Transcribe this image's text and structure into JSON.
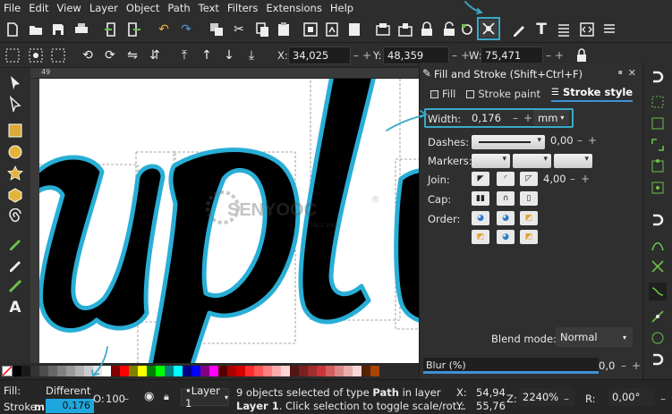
{
  "menu": [
    "File",
    "Edit",
    "View",
    "Layer",
    "Object",
    "Path",
    "Text",
    "Filters",
    "Extensions",
    "Help"
  ],
  "toolbar_icons": [
    "new-icon",
    "open-icon",
    "save-icon",
    "print-icon",
    "import-icon",
    "export-icon",
    "undo-icon",
    "redo-icon",
    "duplicate-icon",
    "cut-icon",
    "copy-icon",
    "paste-icon",
    "zoom-fit-icon",
    "zoom-drawing-icon",
    "zoom-page-icon",
    "group-icon",
    "ungroup-icon",
    "lock-icon",
    "unlock-icon",
    "node-editor-icon",
    "fill-stroke-icon",
    "pen-icon",
    "text-icon",
    "align-icon",
    "xml-editor-icon",
    "more-icon"
  ],
  "controls": {
    "x_label": "X:",
    "x_value": "34,025",
    "y_label": "Y:",
    "y_value": "48,359",
    "w_label": "W:",
    "w_value": "75,471"
  },
  "ruler": {
    "tick_label": "49"
  },
  "canvas": {
    "text": "upl",
    "watermark": "SENYOOC",
    "watermark_sub": "SINCE 2008"
  },
  "dialog": {
    "title": "Fill and Stroke (Shift+Ctrl+F)",
    "tabs": [
      "Fill",
      "Stroke paint",
      "Stroke style"
    ],
    "width_label": "Width:",
    "width_value": "0,176",
    "width_unit": "mm",
    "dashes_label": "Dashes:",
    "dashes_value": "0,00",
    "markers_label": "Markers:",
    "join_label": "Join:",
    "join_value": "4,00",
    "cap_label": "Cap:",
    "order_label": "Order:",
    "blend_label": "Blend mode:",
    "blend_value": "Normal",
    "blur_label": "Blur (%)",
    "blur_value": "0,0"
  },
  "palette": [
    "#000000",
    "#1a1a1a",
    "#333333",
    "#4d4d4d",
    "#666666",
    "#808080",
    "#999999",
    "#b3b3b3",
    "#cccccc",
    "#e6e6e6",
    "#ffffff",
    "#800000",
    "#ff0000",
    "#808000",
    "#ffff00",
    "#008000",
    "#00ff00",
    "#008080",
    "#00ffff",
    "#000080",
    "#0000ff",
    "#800080",
    "#ff00ff",
    "#550000",
    "#aa0000",
    "#d40000",
    "#ff2a2a",
    "#ff5555",
    "#ff8080",
    "#ffaaaa",
    "#ffd5d5",
    "#501616",
    "#782121",
    "#a02c2c",
    "#c83737",
    "#d35f5f",
    "#de8787",
    "#e9afaf",
    "#f4d7d7",
    "#552200",
    "#aa4400"
  ],
  "status": {
    "fill_label": "Fill:",
    "fill_value": "Different",
    "stroke_label": "Stroke:",
    "stroke_value": "0,176",
    "opacity_label": "O:",
    "opacity_value": "100",
    "layer": "•Layer 1",
    "message_line1_prefix": "9 objects selected of type ",
    "message_type": "Path",
    "message_line1_suffix": " in layer",
    "message_line2_layer": "Layer 1",
    "message_line2": ". Click selection to toggle scale/rot...",
    "x_label": "X:",
    "x_value": "54,94",
    "y_label": "Y:",
    "y_value": "55,76",
    "z_label": "Z:",
    "z_value": "2240%",
    "r_label": "R:",
    "r_value": "0,00°"
  },
  "colors": {
    "accent": "#3aa9c9",
    "stroke": "#29aed6",
    "tab_underline": "#3e91d6"
  }
}
